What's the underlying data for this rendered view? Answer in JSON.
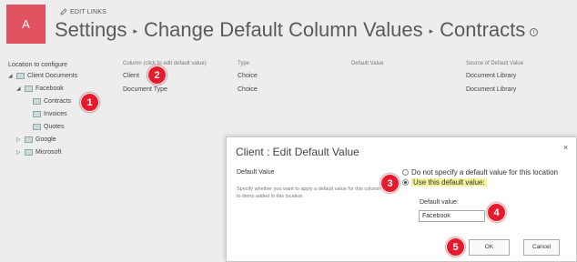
{
  "header": {
    "logo_letter": "A",
    "edit_links": "EDIT LINKS",
    "breadcrumb": [
      "Settings",
      "Change Default Column Values",
      "Contracts"
    ],
    "separator": "▸"
  },
  "location": {
    "title": "Location to configure",
    "tree": [
      {
        "label": "Client Documents",
        "arrow": "◢"
      },
      {
        "label": "Facebook",
        "arrow": "◢"
      },
      {
        "label": "Contracts",
        "arrow": ""
      },
      {
        "label": "Invoices",
        "arrow": ""
      },
      {
        "label": "Quotes",
        "arrow": ""
      },
      {
        "label": "Google",
        "arrow": "▷"
      },
      {
        "label": "Microsoft",
        "arrow": "▷"
      }
    ]
  },
  "table": {
    "headers": [
      "Column (click to edit default value)",
      "Type",
      "Default Value",
      "Source of Default Value"
    ],
    "rows": [
      {
        "column": "Client",
        "type": "Choice",
        "default": "",
        "source": "Document Library"
      },
      {
        "column": "Document Type",
        "type": "Choice",
        "default": "",
        "source": "Document Library"
      }
    ]
  },
  "dialog": {
    "title": "Client : Edit Default Value",
    "close": "×",
    "section_label": "Default Value",
    "description": "Specify whether you want to apply a default value for this column to items added in this location.",
    "radio_no_default": "Do not specify a default value for this location",
    "radio_use_default": "Use this default value:",
    "default_value_label": "Default value:",
    "default_value": "Facebook",
    "ok_label": "OK",
    "cancel_label": "Cancel"
  },
  "badges": [
    "1",
    "2",
    "3",
    "4",
    "5"
  ],
  "colors": {
    "logo": "#e0525f",
    "badge": "#e8192c",
    "highlight": "#f3f39a"
  }
}
